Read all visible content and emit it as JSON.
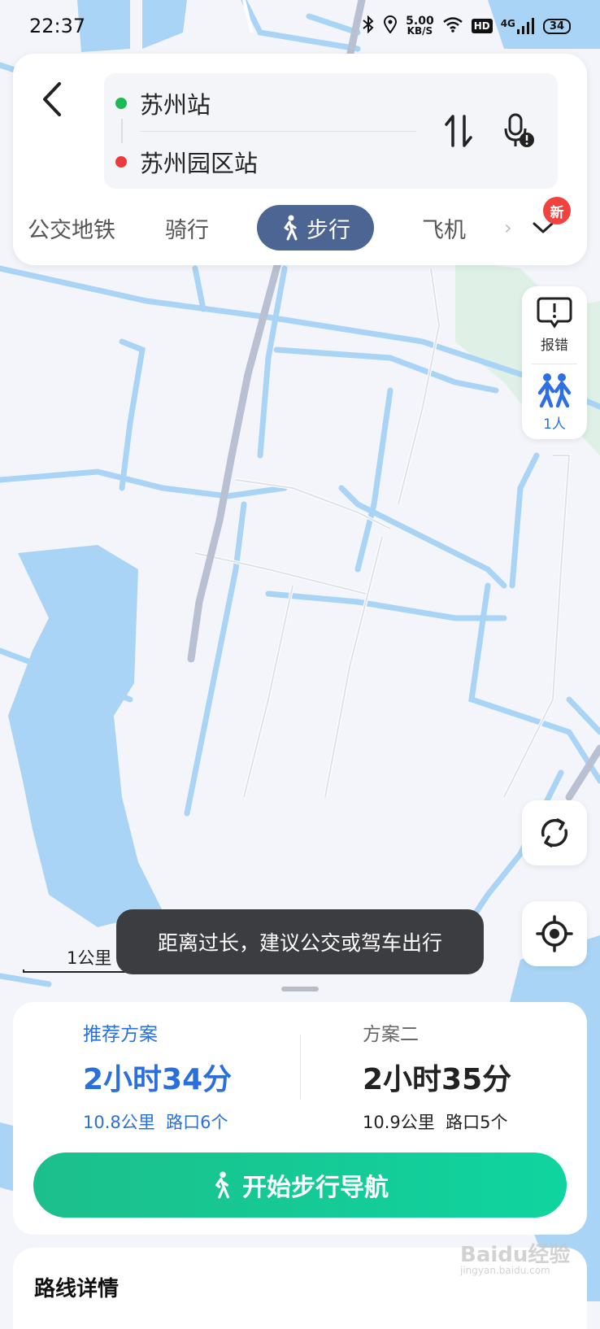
{
  "status": {
    "time": "22:37",
    "speed_value": "5.00",
    "speed_unit": "KB/S",
    "hd": "HD",
    "network": "4G",
    "battery": "34"
  },
  "route": {
    "start": "苏州站",
    "end": "苏州园区站"
  },
  "modes": [
    {
      "label": "公交地铁"
    },
    {
      "label": "骑行"
    },
    {
      "label": "步行"
    },
    {
      "label": "飞机"
    }
  ],
  "new_badge": "新",
  "side": {
    "report_label": "报错",
    "people_label": "1人"
  },
  "scale_label": "1公里",
  "toast": "距离过长，建议公交或驾车出行",
  "plans": [
    {
      "label": "推荐方案",
      "time": "2小时34分",
      "meta": "10.8公里  路口6个"
    },
    {
      "label": "方案二",
      "time": "2小时35分",
      "meta": "10.9公里  路口5个"
    }
  ],
  "nav_button": "开始步行导航",
  "details_title": "路线详情",
  "watermark": {
    "text": "Baidu经验",
    "sub": "jingyan.baidu.com"
  },
  "colors": {
    "water": "#a9d4f5",
    "land": "#f3f5fa",
    "active_tab": "#4d6593",
    "nav_green": "#17c895",
    "recommend_blue": "#2b6fdc"
  }
}
